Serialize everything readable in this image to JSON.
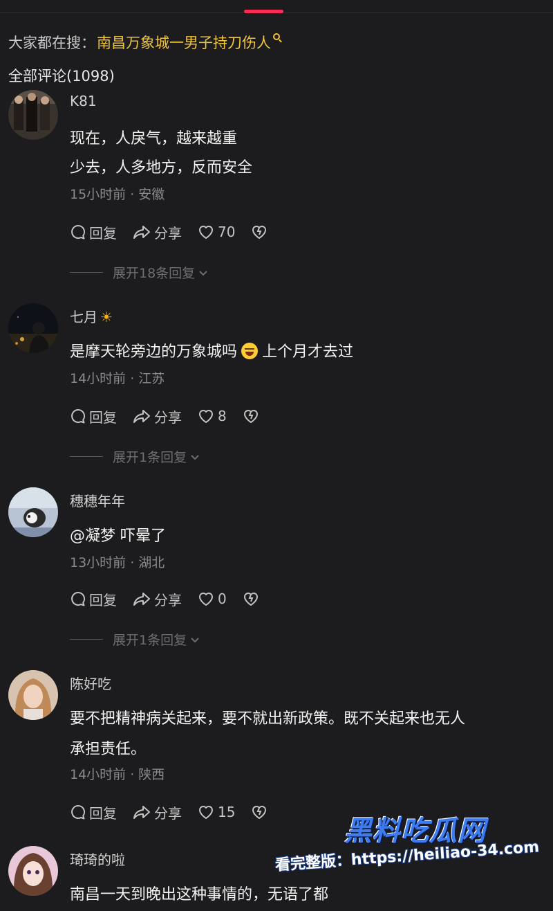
{
  "header": {
    "hot_search_prefix": "大家都在搜：",
    "hot_search_keyword": "南昌万象城一男子持刀伤人",
    "comments_title": "全部评论(1098)"
  },
  "colors": {
    "accent": "#fe2c55",
    "keyword": "#f0c53a",
    "background": "#1c1c1e",
    "muted": "#8a8a8e"
  },
  "icons": [
    "search-icon",
    "reply-icon",
    "share-icon",
    "like-icon",
    "dislike-icon",
    "chevron-down-icon",
    "sun-icon",
    "laughing-emoji-icon"
  ],
  "comments": [
    {
      "username": "K81",
      "lines": [
        "现在，人戾气，越来越重",
        "少去，人多地方，反而安全"
      ],
      "meta": "15小时前 · 安徽",
      "reply": "回复",
      "share": "分享",
      "likes": "70",
      "expand": "展开18条回复"
    },
    {
      "username": "七月",
      "lines": [
        "是摩天轮旁边的万象城吗",
        "上个月才去过"
      ],
      "meta": "14小时前 · 江苏",
      "reply": "回复",
      "share": "分享",
      "likes": "8",
      "expand": "展开1条回复"
    },
    {
      "username": "穗穗年年",
      "lines": [
        "@凝梦 吓晕了"
      ],
      "meta": "13小时前 · 湖北",
      "reply": "回复",
      "share": "分享",
      "likes": "0",
      "expand": "展开1条回复"
    },
    {
      "username": "陈好吃",
      "lines": [
        "要不把精神病关起来，要不就出新政策。既不关起来也无人",
        "承担责任。"
      ],
      "meta": "14小时前 · 陕西",
      "reply": "回复",
      "share": "分享",
      "likes": "15"
    },
    {
      "username": "琦琦的啦",
      "lines": [
        "南昌一天到晚出这种事情的，无语了都"
      ]
    }
  ],
  "watermark": {
    "brand": "黑料吃瓜网",
    "url": "看完整版：https://heiliao-34.com"
  }
}
